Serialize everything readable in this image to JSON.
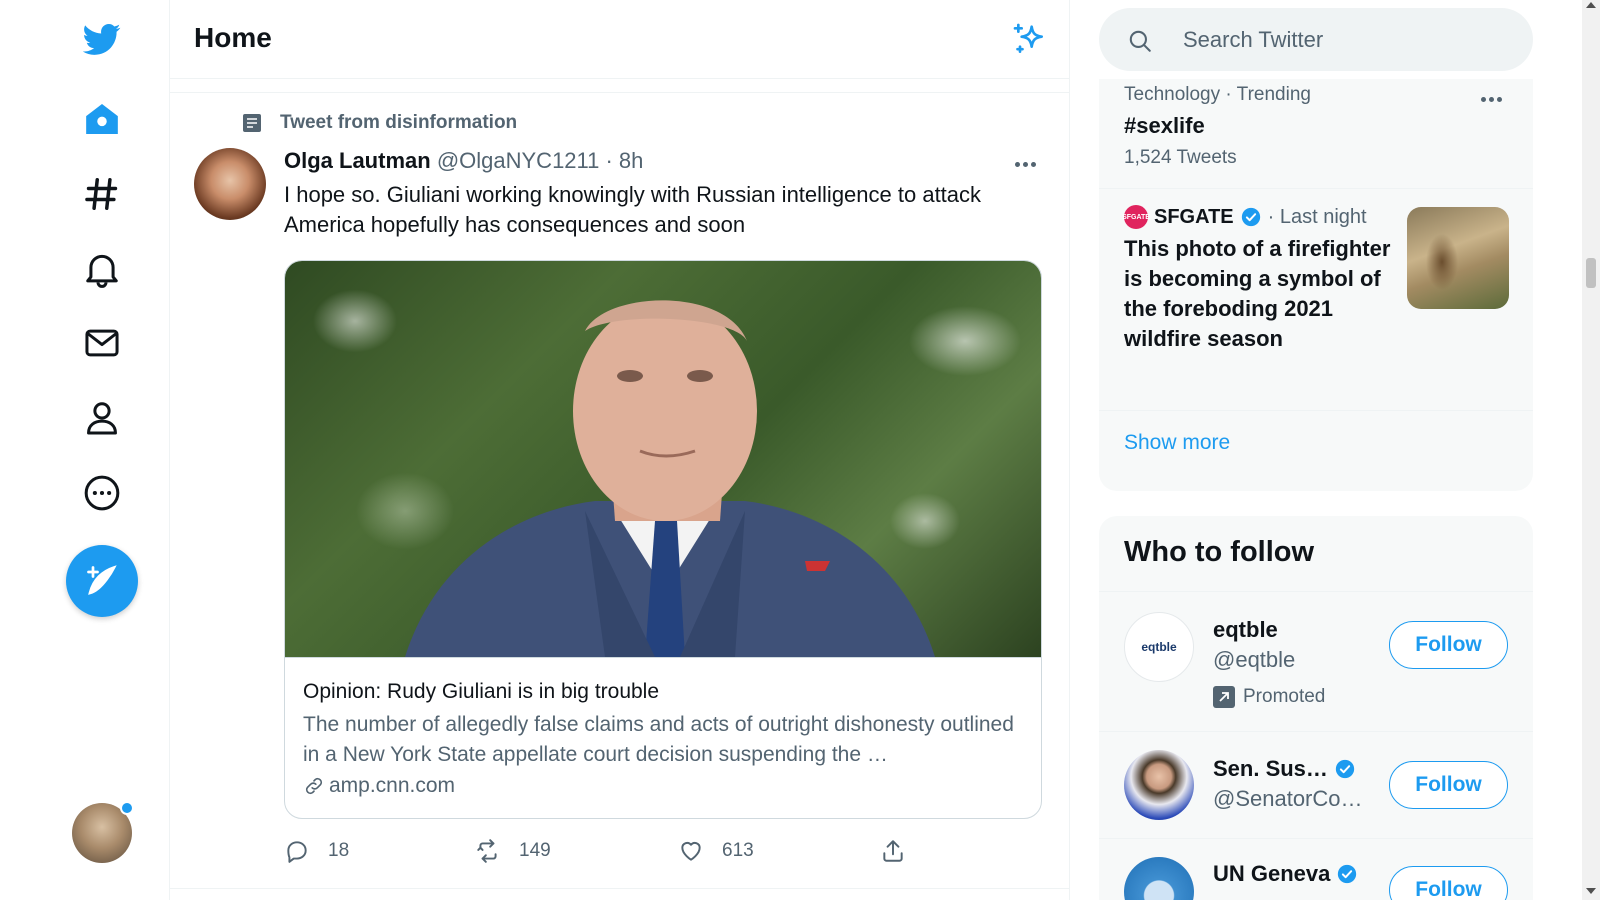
{
  "app": {
    "name": "Twitter",
    "accent_color": "#1d9bf0"
  },
  "nav": {
    "items": [
      {
        "name": "twitter-logo-icon"
      },
      {
        "name": "home-icon"
      },
      {
        "name": "explore-hashtag-icon"
      },
      {
        "name": "notifications-bell-icon"
      },
      {
        "name": "messages-envelope-icon"
      },
      {
        "name": "profile-person-icon"
      },
      {
        "name": "more-options-icon"
      }
    ],
    "compose_icon": "compose-quill-icon"
  },
  "header": {
    "title": "Home",
    "sparkle_icon": "top-tweets-sparkle-icon"
  },
  "tweet": {
    "context": "Tweet from disinformation",
    "author_name": "Olga Lautman",
    "author_handle": "@OlgaNYC1211",
    "time": " · 8h",
    "text": "I hope so. Giuliani working knowingly with Russian intelligence to attack America hopefully has consequences and soon",
    "card": {
      "title": "Opinion: Rudy Giuliani is in big trouble",
      "description": "The number of allegedly false claims and acts of outright dishonesty outlined in a New York State appellate court decision suspending the …",
      "domain": "amp.cnn.com"
    },
    "replies": "18",
    "retweets": "149",
    "likes": "613"
  },
  "search": {
    "placeholder": "Search Twitter"
  },
  "trends": {
    "trend": {
      "meta": "Technology · Trending",
      "name": "#sexlife",
      "count": "1,524 Tweets"
    },
    "news": {
      "source": "SFGATE",
      "logo_text": "SFGATE",
      "time": "· Last night",
      "headline": "This photo of a firefighter is becoming a symbol of the foreboding 2021 wildfire season"
    },
    "show_more": "Show more"
  },
  "who_to_follow": {
    "title": "Who to follow",
    "logo_text": "eqtble",
    "items": [
      {
        "name": "eqtble",
        "handle": "@eqtble",
        "promoted": "Promoted",
        "button": "Follow"
      },
      {
        "name": "Sen. Sus…",
        "handle": "@SenatorCo…",
        "button": "Follow"
      },
      {
        "name": "UN Geneva",
        "button": "Follow"
      }
    ]
  }
}
